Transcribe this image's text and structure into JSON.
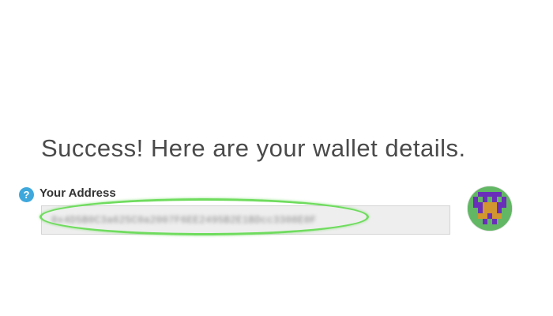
{
  "headline": "Success! Here are your wallet details.",
  "address_section": {
    "label": "Your Address",
    "help_icon": "question-circle-icon",
    "value": "0x4D5B0C3a625C0a2007F6EE2495B2E1BDcc3308E0F"
  },
  "avatar": {
    "type": "identicon",
    "colors": {
      "background": "#62b765",
      "primary": "#6a2fb8",
      "secondary": "#d1962f"
    }
  },
  "highlight": {
    "color": "#6fdc5e",
    "target": "address-input"
  },
  "colors": {
    "headline": "#4a4a4a",
    "help_icon": "#3ea8dc",
    "input_background": "#eeeeee"
  }
}
